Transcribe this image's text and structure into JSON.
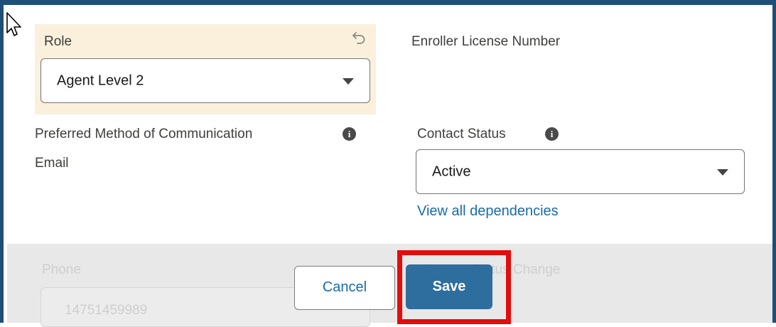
{
  "form": {
    "role": {
      "label": "Role",
      "value": "Agent Level 2"
    },
    "enroller_license": {
      "label": "Enroller License Number"
    },
    "preferred_method": {
      "label": "Preferred Method of Communication",
      "value": "Email"
    },
    "contact_status": {
      "label": "Contact Status",
      "value": "Active",
      "link": "View all dependencies"
    }
  },
  "background_form": {
    "phone_label": "Phone",
    "phone_value": "14751459989",
    "status_change_label": "Contact Status Change"
  },
  "modal_footer": {
    "cancel_label": "Cancel",
    "save_label": "Save"
  },
  "icons": {
    "info": "info-icon",
    "undo": "undo-icon",
    "caret": "chevron-down-icon",
    "cursor": "mouse-pointer-icon"
  },
  "colors": {
    "frame": "#1f4e79",
    "highlight": "#e20d0d",
    "save_button": "#2e6e9e",
    "link": "#1b6aa6",
    "edited_cell": "#faf0dc"
  }
}
